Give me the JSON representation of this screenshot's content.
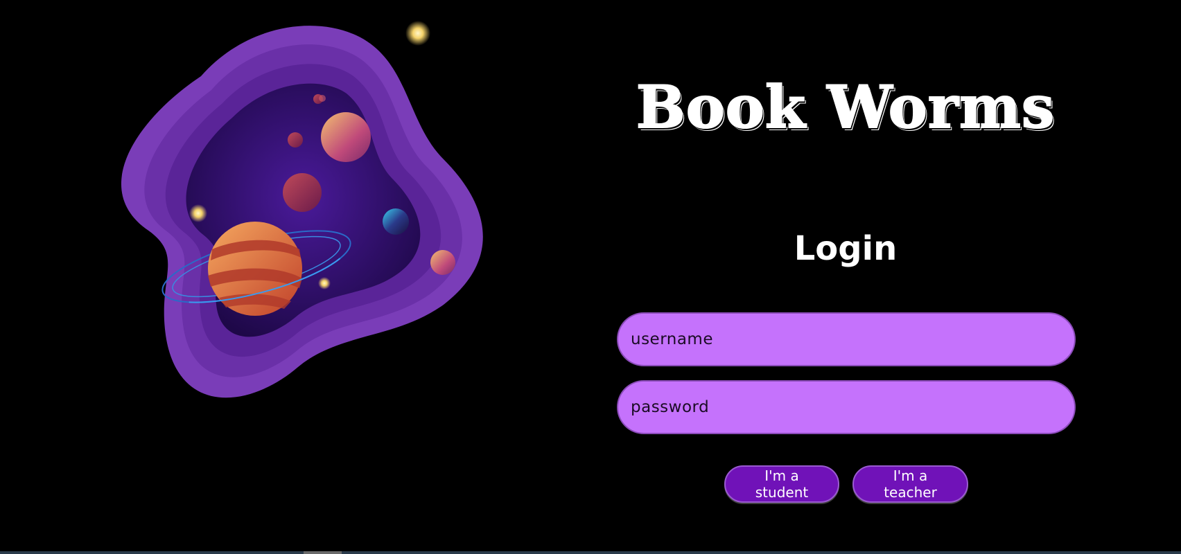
{
  "app": {
    "title": "Book Worms"
  },
  "login": {
    "heading": "Login",
    "username_placeholder": "username",
    "password_placeholder": "password",
    "student_button": "I'm a student",
    "teacher_button": "I'm a teacher"
  },
  "colors": {
    "background": "#000000",
    "input_fill": "#c572fc",
    "button_fill": "#7012b8",
    "text": "#ffffff",
    "illustration_purple": "#7a3db8",
    "illustration_deep": "#2a0a5a"
  },
  "illustration": {
    "icon": "space-planet-illustration"
  }
}
